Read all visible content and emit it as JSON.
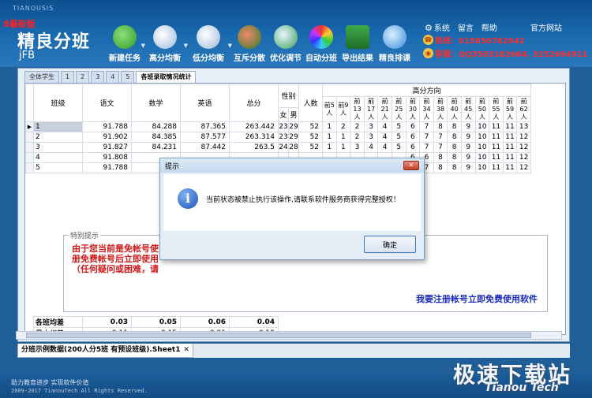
{
  "app": {
    "name": "TIANOUSIS",
    "edition": "8最新版",
    "logo_title": "精良分班",
    "logo_sub": "jFB"
  },
  "toolbar": [
    {
      "label": "新建任务",
      "icon": "plus-icon",
      "arrow": true
    },
    {
      "label": "高分均衡",
      "icon": "balance-high-icon",
      "arrow": true
    },
    {
      "label": "低分均衡",
      "icon": "balance-low-icon",
      "arrow": true
    },
    {
      "label": "互斥分散",
      "icon": "people-icon",
      "arrow": false
    },
    {
      "label": "优化调节",
      "icon": "toggle-icon",
      "arrow": false
    },
    {
      "label": "自动分班",
      "icon": "color-wheel-icon",
      "arrow": false
    },
    {
      "label": "导出结果",
      "icon": "excel-icon",
      "arrow": false
    },
    {
      "label": "精良排课",
      "icon": "globe-icon",
      "arrow": false
    }
  ],
  "top_links": [
    "系统",
    "留言",
    "帮助"
  ],
  "official_site": "官方网站",
  "contact": {
    "hotline": "热线：015850782642",
    "qq": "答服：QQ3503182664, 3252694911"
  },
  "tabs": [
    "全体学生",
    "1",
    "2",
    "3",
    "4",
    "5",
    "各班录取情况统计"
  ],
  "grid": {
    "headers": {
      "class": "班级",
      "chinese": "语文",
      "math": "数学",
      "english": "英语",
      "total": "总分",
      "gender": "性别",
      "female": "女",
      "male": "男",
      "count": "人数",
      "high_dir": "高分方向"
    },
    "high_cols": [
      [
        "前5",
        "人"
      ],
      [
        "前9",
        "人"
      ],
      [
        "前",
        "13",
        "人"
      ],
      [
        "前",
        "17",
        "人"
      ],
      [
        "前",
        "21",
        "人"
      ],
      [
        "前",
        "25",
        "人"
      ],
      [
        "前",
        "30",
        "人"
      ],
      [
        "前",
        "34",
        "人"
      ],
      [
        "前",
        "38",
        "人"
      ],
      [
        "前",
        "40",
        "人"
      ],
      [
        "前",
        "45",
        "人"
      ],
      [
        "前",
        "50",
        "人"
      ],
      [
        "前",
        "55",
        "人"
      ],
      [
        "前",
        "59",
        "人"
      ],
      [
        "前",
        "62",
        "人"
      ]
    ],
    "rows": [
      {
        "cls": "1",
        "chinese": "91.788",
        "math": "84.288",
        "english": "87.365",
        "total": "263.442",
        "female": "23",
        "male": "29",
        "count": "52",
        "h": [
          "1",
          "2",
          "2",
          "3",
          "4",
          "5",
          "6",
          "7",
          "8",
          "8",
          "9",
          "10",
          "11",
          "11",
          "13"
        ]
      },
      {
        "cls": "2",
        "chinese": "91.902",
        "math": "84.385",
        "english": "87.577",
        "total": "263.314",
        "female": "23",
        "male": "29",
        "count": "52",
        "h": [
          "1",
          "1",
          "2",
          "3",
          "4",
          "5",
          "6",
          "7",
          "7",
          "8",
          "9",
          "10",
          "11",
          "11",
          "12"
        ]
      },
      {
        "cls": "3",
        "chinese": "91.827",
        "math": "84.231",
        "english": "87.442",
        "total": "263.5",
        "female": "24",
        "male": "28",
        "count": "52",
        "h": [
          "1",
          "1",
          "3",
          "4",
          "4",
          "5",
          "6",
          "7",
          "7",
          "8",
          "9",
          "10",
          "11",
          "11",
          "12"
        ]
      },
      {
        "cls": "4",
        "chinese": "91.808",
        "math": "",
        "english": "",
        "total": "",
        "female": "",
        "male": "",
        "count": "",
        "h": [
          "",
          "",
          "",
          "",
          "",
          "",
          "6",
          "6",
          "8",
          "8",
          "9",
          "10",
          "11",
          "11",
          "12"
        ]
      },
      {
        "cls": "5",
        "chinese": "91.788",
        "math": "",
        "english": "",
        "total": "",
        "female": "",
        "male": "",
        "count": "",
        "h": [
          "",
          "",
          "",
          "",
          "",
          "",
          "6",
          "7",
          "8",
          "8",
          "9",
          "10",
          "11",
          "11",
          "12"
        ]
      }
    ]
  },
  "notice": {
    "title": "特别提示",
    "line1": "由于您当前是免帐号使                                                后缀标记）。您可以注",
    "line2": "册免费帐号后立即使用",
    "line3": "（任何疑问或困难，请",
    "register": "我要注册帐号立即免费使用软件"
  },
  "summary": [
    {
      "label": "各班均差",
      "values": [
        "0.03",
        "0.05",
        "0.06",
        "0.04"
      ]
    },
    {
      "label": "最大相差",
      "values": [
        "0.11",
        "0.15",
        "0.21",
        "0.19"
      ]
    }
  ],
  "sheet_tab": "分班示例数据(200人分5班 有预设班级).Sheet1",
  "sheet_close": "✕",
  "footer": {
    "slogan": "助力教育进步    实现软件价值",
    "copyright": "2009-2017 TianouTech All Rights Reserved."
  },
  "watermark": {
    "line1": "极速下载站",
    "line2": "Tianou Tech"
  },
  "dialog": {
    "title": "提示",
    "message": "当前状态被禁止执行该操作,请联系软件服务商获得完整授权！",
    "ok": "确定",
    "close": "✕"
  }
}
